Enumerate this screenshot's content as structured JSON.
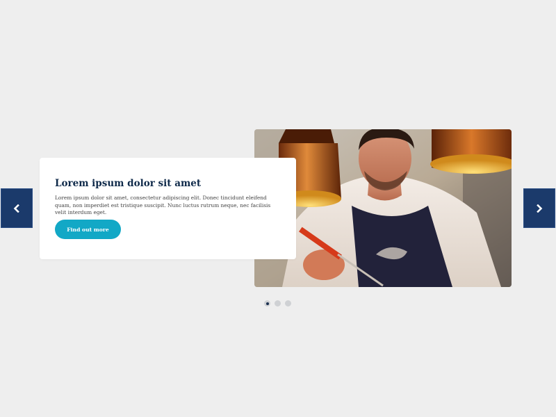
{
  "slider": {
    "title": "Lorem ipsum dolor sit amet",
    "body": "Lorem ipsum dolor sit amet, consectetur adipiscing elit. Donec tincidunt eleifend quam, non imperdiet est tristique suscipit. Nunc luctus rutrum neque, nec facilisis velit interdum eget.",
    "button_label": "Find out more",
    "current_slide": 1,
    "slide_count": 3,
    "image_icon": "chef-photo",
    "prev_icon": "chevron-left-icon",
    "next_icon": "chevron-right-icon"
  },
  "colors": {
    "page_background": "#eeeeee",
    "card_background": "#ffffff",
    "title": "#0f2a4a",
    "button": "#12a8c6",
    "arrow_background": "#1b3a6b",
    "dot_inactive": "#cfd1d4",
    "dot_active": "#1b2f4f"
  }
}
